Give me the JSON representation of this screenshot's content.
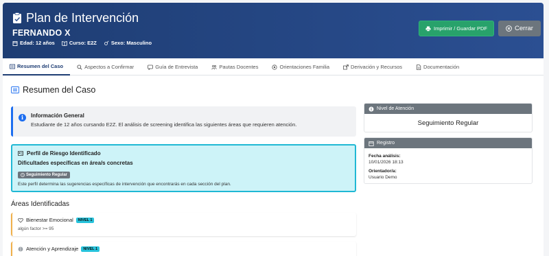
{
  "header": {
    "title": "Plan de Intervención",
    "student_name": "FERNANDO X",
    "age": "Edad: 12 años",
    "course": "Curso: E2Z",
    "sex": "Sexo: Masculino",
    "print_button": "Imprimir / Guardar PDF",
    "close_button": "Cerrar",
    "colors": {
      "header_start": "#1e3d73",
      "header_end": "#2b4f92",
      "print": "#28a26b",
      "close": "#6c757d"
    }
  },
  "tabs": [
    {
      "label": "Resumen del Caso",
      "icon": "list-icon",
      "active": true
    },
    {
      "label": "Aspectos a Confirmar",
      "icon": "search-icon",
      "active": false
    },
    {
      "label": "Guía de Entrevista",
      "icon": "chat-icon",
      "active": false
    },
    {
      "label": "Pautas Docentes",
      "icon": "people-icon",
      "active": false
    },
    {
      "label": "Orientaciones Familia",
      "icon": "home-icon",
      "active": false
    },
    {
      "label": "Derivación y Recursos",
      "icon": "share-icon",
      "active": false
    },
    {
      "label": "Documentación",
      "icon": "document-icon",
      "active": false
    }
  ],
  "main": {
    "section_title": "Resumen del Caso",
    "info": {
      "title": "Información General",
      "text": "Estudiante de 12 años cursando E2Z. El análisis de screening identifica las siguientes áreas que requieren atención."
    },
    "risk": {
      "title": "Perfil de Riesgo Identificado",
      "subtitle": "Dificultades específicas en área/s concretas",
      "badge": "Seguimiento Regular",
      "note": "Este perfil determina las sugerencias específicas de intervención que encontrarás en cada sección del plan."
    },
    "areas_title": "Áreas Identificadas",
    "areas": [
      {
        "name": "Bienestar Emocional",
        "level": "NIVEL 1",
        "factor": "algún factor >= 95",
        "icon": "heart-icon"
      },
      {
        "name": "Atención y Aprendizaje",
        "level": "NIVEL 1",
        "factor": "",
        "icon": "brain-icon"
      }
    ]
  },
  "side": {
    "level_title": "Nivel de Atención",
    "level_value": "Seguimiento Regular",
    "registro_title": "Registro",
    "fecha_label": "Fecha análisis:",
    "fecha_value": "10/01/2026 18:13",
    "orientador_label": "Orientador/a:",
    "orientador_value": "Usuario Demo"
  }
}
